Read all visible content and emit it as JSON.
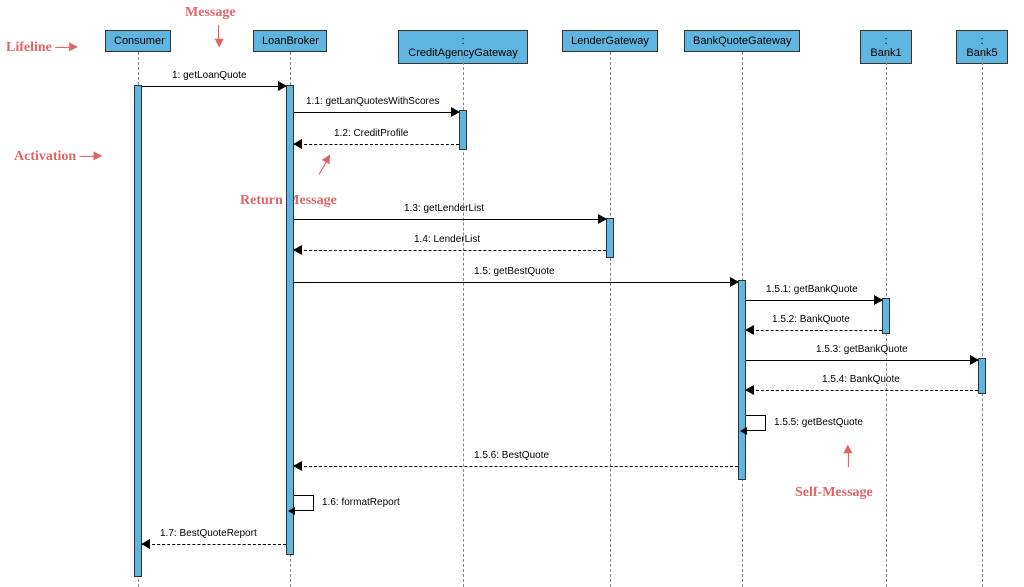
{
  "participants": {
    "consumer": "Consumer",
    "loanbroker": "LoanBroker",
    "creditagency": ": CreditAgencyGateway",
    "lender": "LenderGateway",
    "bankquote": "BankQuoteGateway",
    "bank1": ": Bank1",
    "bank5": ": Bank5"
  },
  "messages": {
    "m1": "1: getLoanQuote",
    "m1_1": "1.1: getLanQuotesWithScores",
    "m1_2": "1.2: CreditProfile",
    "m1_3": "1.3: getLenderList",
    "m1_4": "1.4: LenderList",
    "m1_5": "1.5: getBestQuote",
    "m1_5_1": "1.5.1: getBankQuote",
    "m1_5_2": "1.5.2: BankQuote",
    "m1_5_3": "1.5.3: getBankQuote",
    "m1_5_4": "1.5.4: BankQuote",
    "m1_5_5": "1.5.5: getBestQuote",
    "m1_5_6": "1.5.6: BestQuote",
    "m1_6": "1.6: formatReport",
    "m1_7": "1.7: BestQuoteReport"
  },
  "annotations": {
    "lifeline": "Lifeline",
    "message": "Message",
    "activation": "Activation",
    "return_message": "Return Message",
    "self_message": "Self-Message"
  },
  "chart_data": {
    "type": "uml-sequence-diagram",
    "participants": [
      "Consumer",
      "LoanBroker",
      ": CreditAgencyGateway",
      "LenderGateway",
      "BankQuoteGateway",
      ": Bank1",
      ": Bank5"
    ],
    "interactions": [
      {
        "seq": "1",
        "from": "Consumer",
        "to": "LoanBroker",
        "label": "getLoanQuote",
        "type": "sync"
      },
      {
        "seq": "1.1",
        "from": "LoanBroker",
        "to": ": CreditAgencyGateway",
        "label": "getLanQuotesWithScores",
        "type": "sync"
      },
      {
        "seq": "1.2",
        "from": ": CreditAgencyGateway",
        "to": "LoanBroker",
        "label": "CreditProfile",
        "type": "return"
      },
      {
        "seq": "1.3",
        "from": "LoanBroker",
        "to": "LenderGateway",
        "label": "getLenderList",
        "type": "sync"
      },
      {
        "seq": "1.4",
        "from": "LenderGateway",
        "to": "LoanBroker",
        "label": "LenderList",
        "type": "return"
      },
      {
        "seq": "1.5",
        "from": "LoanBroker",
        "to": "BankQuoteGateway",
        "label": "getBestQuote",
        "type": "sync"
      },
      {
        "seq": "1.5.1",
        "from": "BankQuoteGateway",
        "to": ": Bank1",
        "label": "getBankQuote",
        "type": "sync"
      },
      {
        "seq": "1.5.2",
        "from": ": Bank1",
        "to": "BankQuoteGateway",
        "label": "BankQuote",
        "type": "return"
      },
      {
        "seq": "1.5.3",
        "from": "BankQuoteGateway",
        "to": ": Bank5",
        "label": "getBankQuote",
        "type": "sync"
      },
      {
        "seq": "1.5.4",
        "from": ": Bank5",
        "to": "BankQuoteGateway",
        "label": "BankQuote",
        "type": "return"
      },
      {
        "seq": "1.5.5",
        "from": "BankQuoteGateway",
        "to": "BankQuoteGateway",
        "label": "getBestQuote",
        "type": "self"
      },
      {
        "seq": "1.5.6",
        "from": "BankQuoteGateway",
        "to": "LoanBroker",
        "label": "BestQuote",
        "type": "return"
      },
      {
        "seq": "1.6",
        "from": "LoanBroker",
        "to": "LoanBroker",
        "label": "formatReport",
        "type": "self"
      },
      {
        "seq": "1.7",
        "from": "LoanBroker",
        "to": "Consumer",
        "label": "BestQuoteReport",
        "type": "return"
      }
    ],
    "annotations_callouts": [
      "Lifeline",
      "Message",
      "Activation",
      "Return Message",
      "Self-Message"
    ]
  }
}
